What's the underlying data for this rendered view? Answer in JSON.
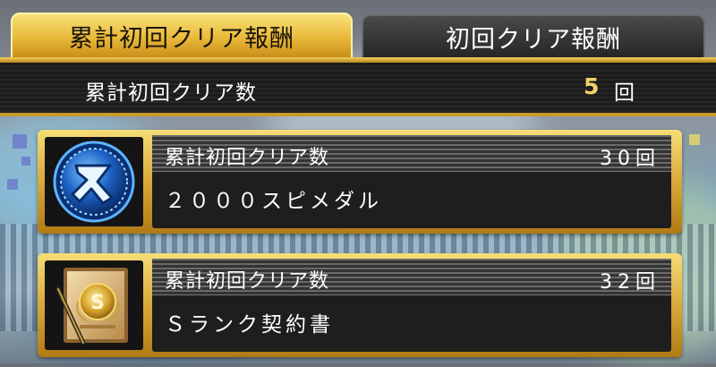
{
  "tabs": [
    {
      "label": "累計初回クリア報酬",
      "active": true
    },
    {
      "label": "初回クリア報酬",
      "active": false
    }
  ],
  "summary": {
    "label": "累計初回クリア数",
    "count": "5",
    "unit": "回"
  },
  "rewards": [
    {
      "condition_label": "累計初回クリア数",
      "required": "30回",
      "reward_name": "２０００スピメダル",
      "icon": "spi-medal-icon"
    },
    {
      "condition_label": "累計初回クリア数",
      "required": "32回",
      "reward_name": "Ｓランク契約書",
      "icon": "s-rank-contract-icon"
    }
  ],
  "colors": {
    "gold": "#e9b93a",
    "medal_blue": "#1e62c4",
    "count_yellow": "#f2d36b"
  }
}
